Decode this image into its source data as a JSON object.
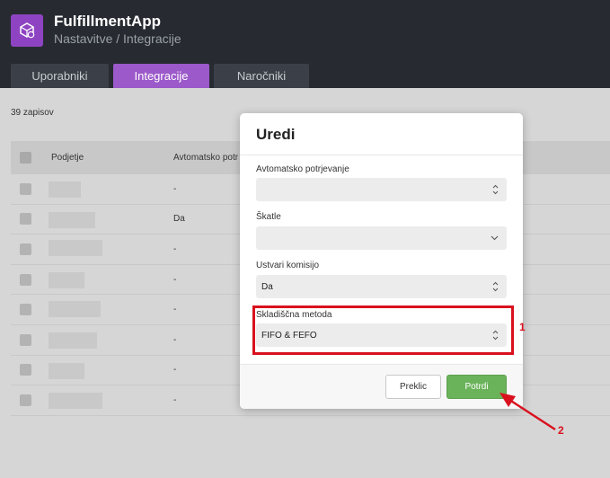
{
  "header": {
    "app_title": "FulfillmentApp",
    "subtitle": "Nastavitve / Integracije",
    "tabs": [
      {
        "label": "Uporabniki",
        "active": false
      },
      {
        "label": "Integracije",
        "active": true
      },
      {
        "label": "Naročniki",
        "active": false
      }
    ],
    "accent_color": "#9b59c9"
  },
  "list": {
    "record_count": "39 zapisov",
    "columns": [
      "Podjetje",
      "Avtomatsko potr"
    ],
    "rows": [
      {
        "value": "-"
      },
      {
        "value": "Da"
      },
      {
        "value": "-"
      },
      {
        "value": "-"
      },
      {
        "value": "-"
      },
      {
        "value": "-"
      },
      {
        "value": "-"
      },
      {
        "value": "-"
      }
    ]
  },
  "modal": {
    "title": "Uredi",
    "fields": [
      {
        "label": "Avtomatsko potrjevanje",
        "value": ""
      },
      {
        "label": "Škatle",
        "value": ""
      },
      {
        "label": "Ustvari komisijo",
        "value": "Da"
      },
      {
        "label": "Skladiščna metoda",
        "value": "FIFO & FEFO"
      }
    ],
    "cancel_label": "Preklic",
    "confirm_label": "Potrdi",
    "confirm_color": "#6bb35b"
  },
  "annotations": {
    "marker_1": "1",
    "marker_2": "2",
    "color": "#d9111e"
  }
}
